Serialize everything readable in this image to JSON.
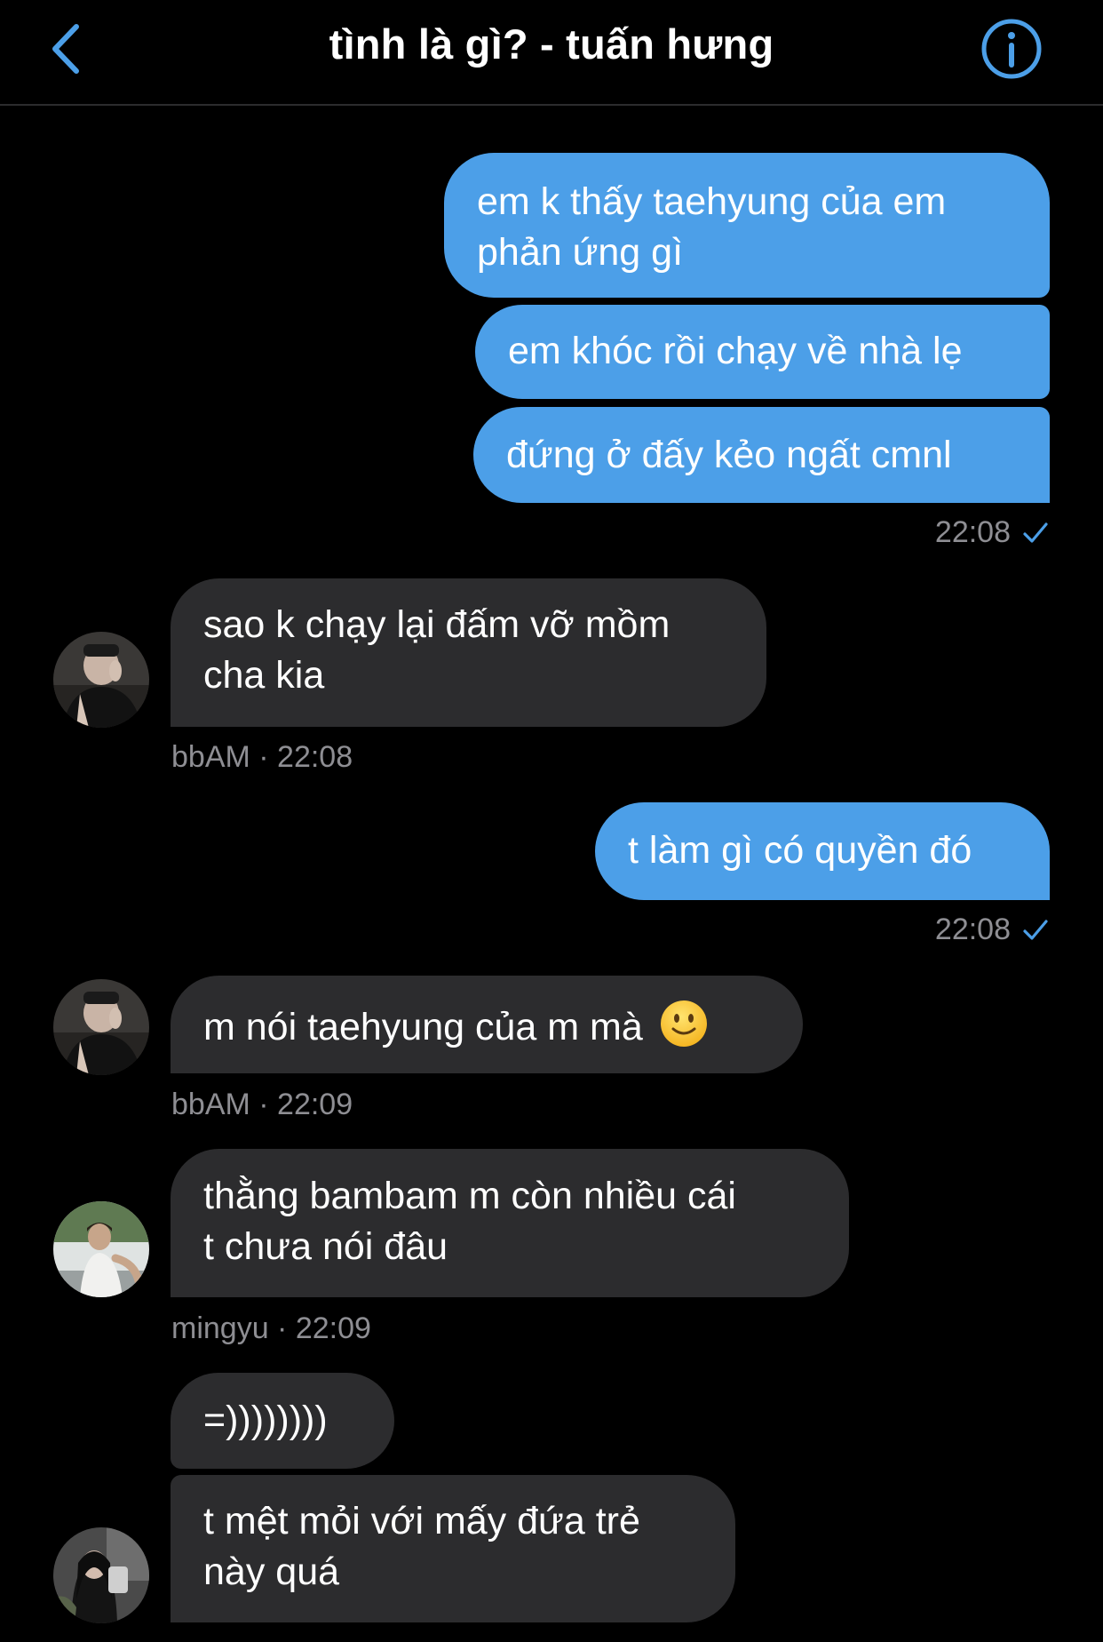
{
  "header": {
    "title": "tình là gì? - tuấn hưng",
    "back_icon": "chevron-left-icon",
    "info_icon": "info-circle-icon"
  },
  "colors": {
    "background": "#000000",
    "outgoing_bubble": "#4c9fe8",
    "incoming_bubble": "#2c2c2e",
    "accent": "#4c9fe8",
    "meta_text": "#8e8e93"
  },
  "messages": [
    {
      "direction": "out",
      "lines": [
        "em k thấy taehyung của em",
        "phản ứng gì"
      ]
    },
    {
      "direction": "out",
      "lines": [
        "em khóc rồi chạy về nhà lẹ"
      ]
    },
    {
      "direction": "out",
      "lines": [
        "đứng ở đấy kẻo ngất cmnl"
      ]
    },
    {
      "direction": "out-meta",
      "time": "22:08",
      "status_icon": "check-icon"
    },
    {
      "direction": "in",
      "lines": [
        "sao k chạy lại đấm vỡ mồm",
        "cha kia"
      ]
    },
    {
      "direction": "in-meta",
      "text": "bbAM · 22:08"
    },
    {
      "direction": "out",
      "lines": [
        "t làm gì có quyền đó"
      ]
    },
    {
      "direction": "out-meta",
      "time": "22:08",
      "status_icon": "check-icon"
    },
    {
      "direction": "in",
      "lines": [
        "m nói taehyung của m mà"
      ],
      "emoji": "slightly-smiling-face-icon"
    },
    {
      "direction": "in-meta",
      "text": "bbAM · 22:09"
    },
    {
      "direction": "in",
      "lines": [
        "thằng bambam m còn nhiều cái",
        "t chưa nói đâu"
      ]
    },
    {
      "direction": "in-meta",
      "text": "mingyu · 22:09"
    },
    {
      "direction": "in",
      "lines": [
        "=))))))))"
      ]
    },
    {
      "direction": "in",
      "lines": [
        "t mệt mỏi với mấy đứa trẻ",
        "này quá"
      ]
    }
  ]
}
